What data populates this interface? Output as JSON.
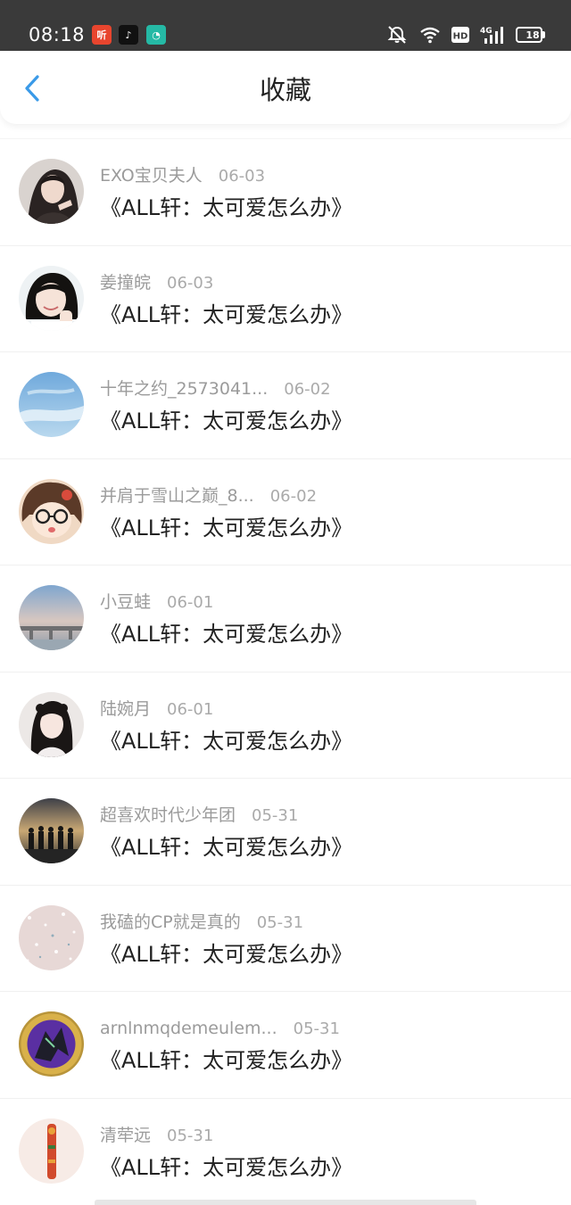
{
  "status_bar": {
    "time": "08:18",
    "apps": [
      {
        "name": "listen-app",
        "glyph": "听",
        "color": "#e8452e"
      },
      {
        "name": "tiktok-app",
        "glyph": "♪",
        "color": "#111111"
      },
      {
        "name": "chat-app",
        "glyph": "◔",
        "color": "#25b9a5"
      }
    ],
    "hd": "HD",
    "network": "4G",
    "battery": "18"
  },
  "header": {
    "title": "收藏"
  },
  "favorites": [
    {
      "user": "EXO宝贝夫人",
      "date": "06-03",
      "title": "《ALL轩：太可爱怎么办》",
      "avatar": "portrait-dark-hair"
    },
    {
      "user": "姜撞皖",
      "date": "06-03",
      "title": "《ALL轩：太可爱怎么办》",
      "avatar": "portrait-thumbs-up"
    },
    {
      "user": "十年之约_2573041...",
      "date": "06-02",
      "title": "《ALL轩：太可爱怎么办》",
      "avatar": "blue-sky"
    },
    {
      "user": "并肩于雪山之巅_8...",
      "date": "06-02",
      "title": "《ALL轩：太可爱怎么办》",
      "avatar": "cartoon-girl-glasses"
    },
    {
      "user": "小豆蛙",
      "date": "06-01",
      "title": "《ALL轩：太可爱怎么办》",
      "avatar": "bridge-sunset"
    },
    {
      "user": "陆婉月",
      "date": "06-01",
      "title": "《ALL轩：太可爱怎么办》",
      "avatar": "portrait-hanfu"
    },
    {
      "user": "超喜欢时代少年团",
      "date": "05-31",
      "title": "《ALL轩：太可爱怎么办》",
      "avatar": "group-silhouettes"
    },
    {
      "user": "我磕的CP就是真的",
      "date": "05-31",
      "title": "《ALL轩：太可爱怎么办》",
      "avatar": "pink-sparkle"
    },
    {
      "user": "arnlnmqdemeulem...",
      "date": "05-31",
      "title": "《ALL轩：太可爱怎么办》",
      "avatar": "gold-medal-dragon"
    },
    {
      "user": "清荦远",
      "date": "05-31",
      "title": "《ALL轩：太可爱怎么办》",
      "avatar": "red-beads"
    }
  ],
  "colors": {
    "accent": "#3a9ae8",
    "status_bar_bg": "#3a3a3a",
    "title_text": "#222222",
    "meta_text": "#9b9b9b"
  }
}
